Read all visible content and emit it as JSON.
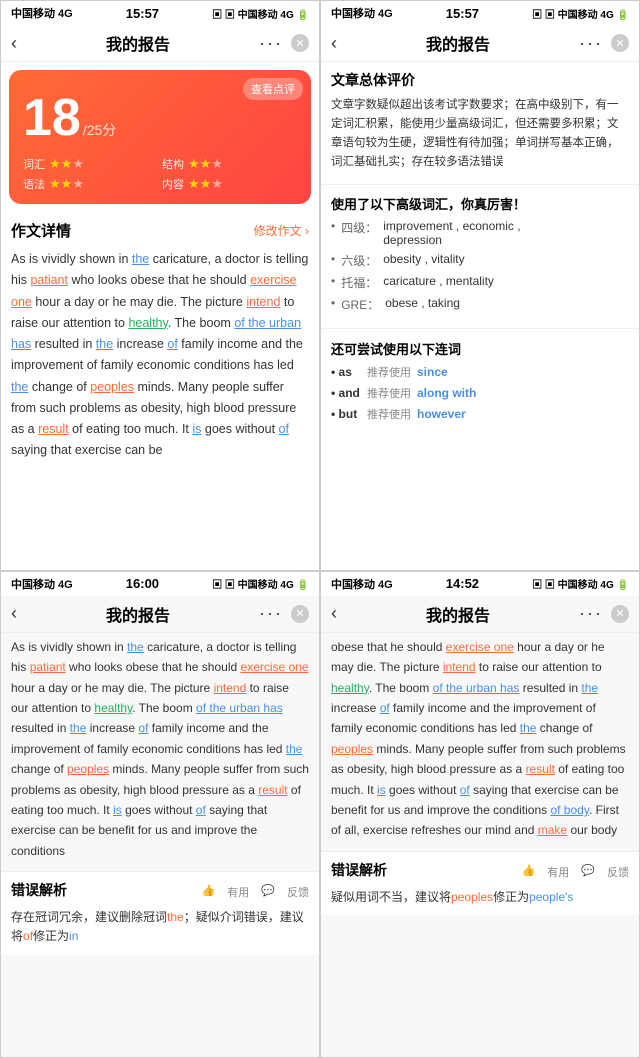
{
  "panels": [
    {
      "id": "panel-top-left",
      "statusBar": {
        "carrier": "中国移动",
        "network": "4G",
        "time": "15:57",
        "batteryCarrier2": "中国移动",
        "network2": "4G"
      },
      "navBar": {
        "back": "‹",
        "title": "我的报告",
        "dots": "···",
        "close": "✕"
      },
      "scoreCard": {
        "checkBtn": "查看点评",
        "score": "18",
        "denom": "/25分",
        "items": [
          {
            "label": "词汇",
            "stars": 2,
            "max": 3
          },
          {
            "label": "结构",
            "stars": 2,
            "max": 3
          },
          {
            "label": "语法",
            "stars": 2,
            "max": 3
          },
          {
            "label": "内容",
            "stars": 2,
            "max": 3
          }
        ]
      },
      "essaySection": {
        "title": "作文详情",
        "actionLabel": "修改作文 ›",
        "text": "As is vividly shown in the caricature, a doctor is telling his patiant who looks obese that he should exercise one hour a day or he may die. The picture intend to raise our attention to healthy. The boom of the urban has resulted in the increase of family income and the improvement of family economic conditions has led the change of peoples minds. Many people suffer from such problems as obesity, high blood pressure as a result of eating too much. It is goes without of saying that exercise can be"
      }
    },
    {
      "id": "panel-top-right",
      "statusBar": {
        "carrier": "中国移动",
        "network": "4G",
        "time": "15:57",
        "batteryCarrier2": "中国移动",
        "network2": "4G"
      },
      "navBar": {
        "back": "‹",
        "title": "我的报告",
        "dots": "···",
        "close": "✕"
      },
      "overallReview": {
        "title": "文章总体评价",
        "text": "文章字数疑似超出该考试字数要求；在高中级别下，有一定词汇积累，能使用少量高级词汇，但还需要多积累；文章语句较为生硬，逻辑性有待加强；单词拼写基本正确，词汇基础扎实；存在较多语法错误"
      },
      "vocabSection": {
        "title": "使用了以下高级词汇，你真厉害！",
        "items": [
          {
            "level": "四级：",
            "words": "improvement , economic , depression"
          },
          {
            "level": "六级：",
            "words": "obesity , vitality"
          },
          {
            "level": "托福：",
            "words": "caricature , mentality"
          },
          {
            "level": "GRE：",
            "words": "obese , taking"
          }
        ]
      },
      "connectorsSection": {
        "title": "还可尝试使用以下连词",
        "items": [
          {
            "word": "as",
            "suggest": "推荐使用",
            "alt": "since"
          },
          {
            "word": "and",
            "suggest": "推荐使用",
            "alt": "along with"
          },
          {
            "word": "but",
            "suggest": "推荐使用",
            "alt": "however"
          }
        ]
      }
    },
    {
      "id": "panel-bottom-left",
      "statusBar": {
        "carrier": "中国移动",
        "network": "4G",
        "time": "16:00"
      },
      "navBar": {
        "back": "‹",
        "title": "我的报告",
        "dots": "···",
        "close": "✕"
      },
      "essayText": "As is vividly shown in the caricature, a doctor is telling his patiant who looks obese that he should exercise one hour a day or he may die. The picture intend to raise our attention to healthy. The boom of the urban has resulted in the increase of family income and the improvement of family economic conditions has led the change of peoples minds. Many people suffer from such problems as obesity, high blood pressure as a result of eating too much. It is goes without of saying that exercise can be benefit for us and improve the conditions",
      "errorSection": {
        "title": "错误解析",
        "useful": "有用",
        "feedback": "反馈",
        "text": "存在冠词冗余，建议删除冠词the；疑似介词错误，建议将of修正为in"
      }
    },
    {
      "id": "panel-bottom-right",
      "statusBar": {
        "carrier": "中国移动",
        "network": "4G",
        "time": "14:52"
      },
      "navBar": {
        "back": "‹",
        "title": "我的报告",
        "dots": "···",
        "close": "✕"
      },
      "essayText": "obese that he should exercise one hour a day or he may die. The picture intend to raise our attention to healthy. The boom of the urban has resulted in the increase of family income and the improvement of family economic conditions has led the change of peoples minds. Many people suffer from such problems as obesity, high blood pressure as a result of eating too much. It is goes without of saying that exercise can be benefit for us and improve the conditions of body. First of all, exercise refreshes our mind and make our body",
      "errorSection": {
        "title": "错误解析",
        "useful": "有用",
        "feedback": "反馈",
        "text": "疑似用词不当，建议将peoples修正为people's"
      }
    }
  ]
}
